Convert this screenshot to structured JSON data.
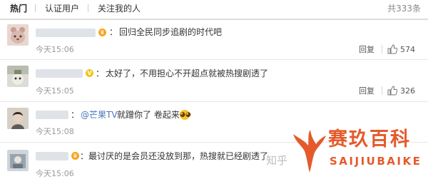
{
  "tabs": [
    {
      "label": "热门",
      "active": true
    },
    {
      "label": "认证用户",
      "active": false
    },
    {
      "label": "关注我的人",
      "active": false
    }
  ],
  "total_count": "共333条",
  "comments": [
    {
      "badge_icon": "gold-crown-icon",
      "text": "回归全民同步追剧的时代吧",
      "time": "今天15:06",
      "reply_label": "回复",
      "likes": "574"
    },
    {
      "badge_icon": "v-verified-icon",
      "text": "太好了，不用担心不开超点就被热搜剧透了",
      "time": "今天15:05",
      "reply_label": "回复",
      "likes": "326"
    },
    {
      "mention": "@芒果TV",
      "text": "就蹭你了 卷起来",
      "time": "今天15:08"
    },
    {
      "badge_icon": "gold-crown-icon",
      "text": "最讨厌的是会员还没放到那，热搜就已经剧透了",
      "time": "今天15:06"
    }
  ],
  "watermark": {
    "zhihu_text": "知乎",
    "logo_cn": "赛玖百科",
    "logo_en": "SAIJIUBAIKE"
  },
  "colors": {
    "mention": "#4a78c0",
    "logo": "#e55a2a",
    "timestamp": "#999999"
  }
}
